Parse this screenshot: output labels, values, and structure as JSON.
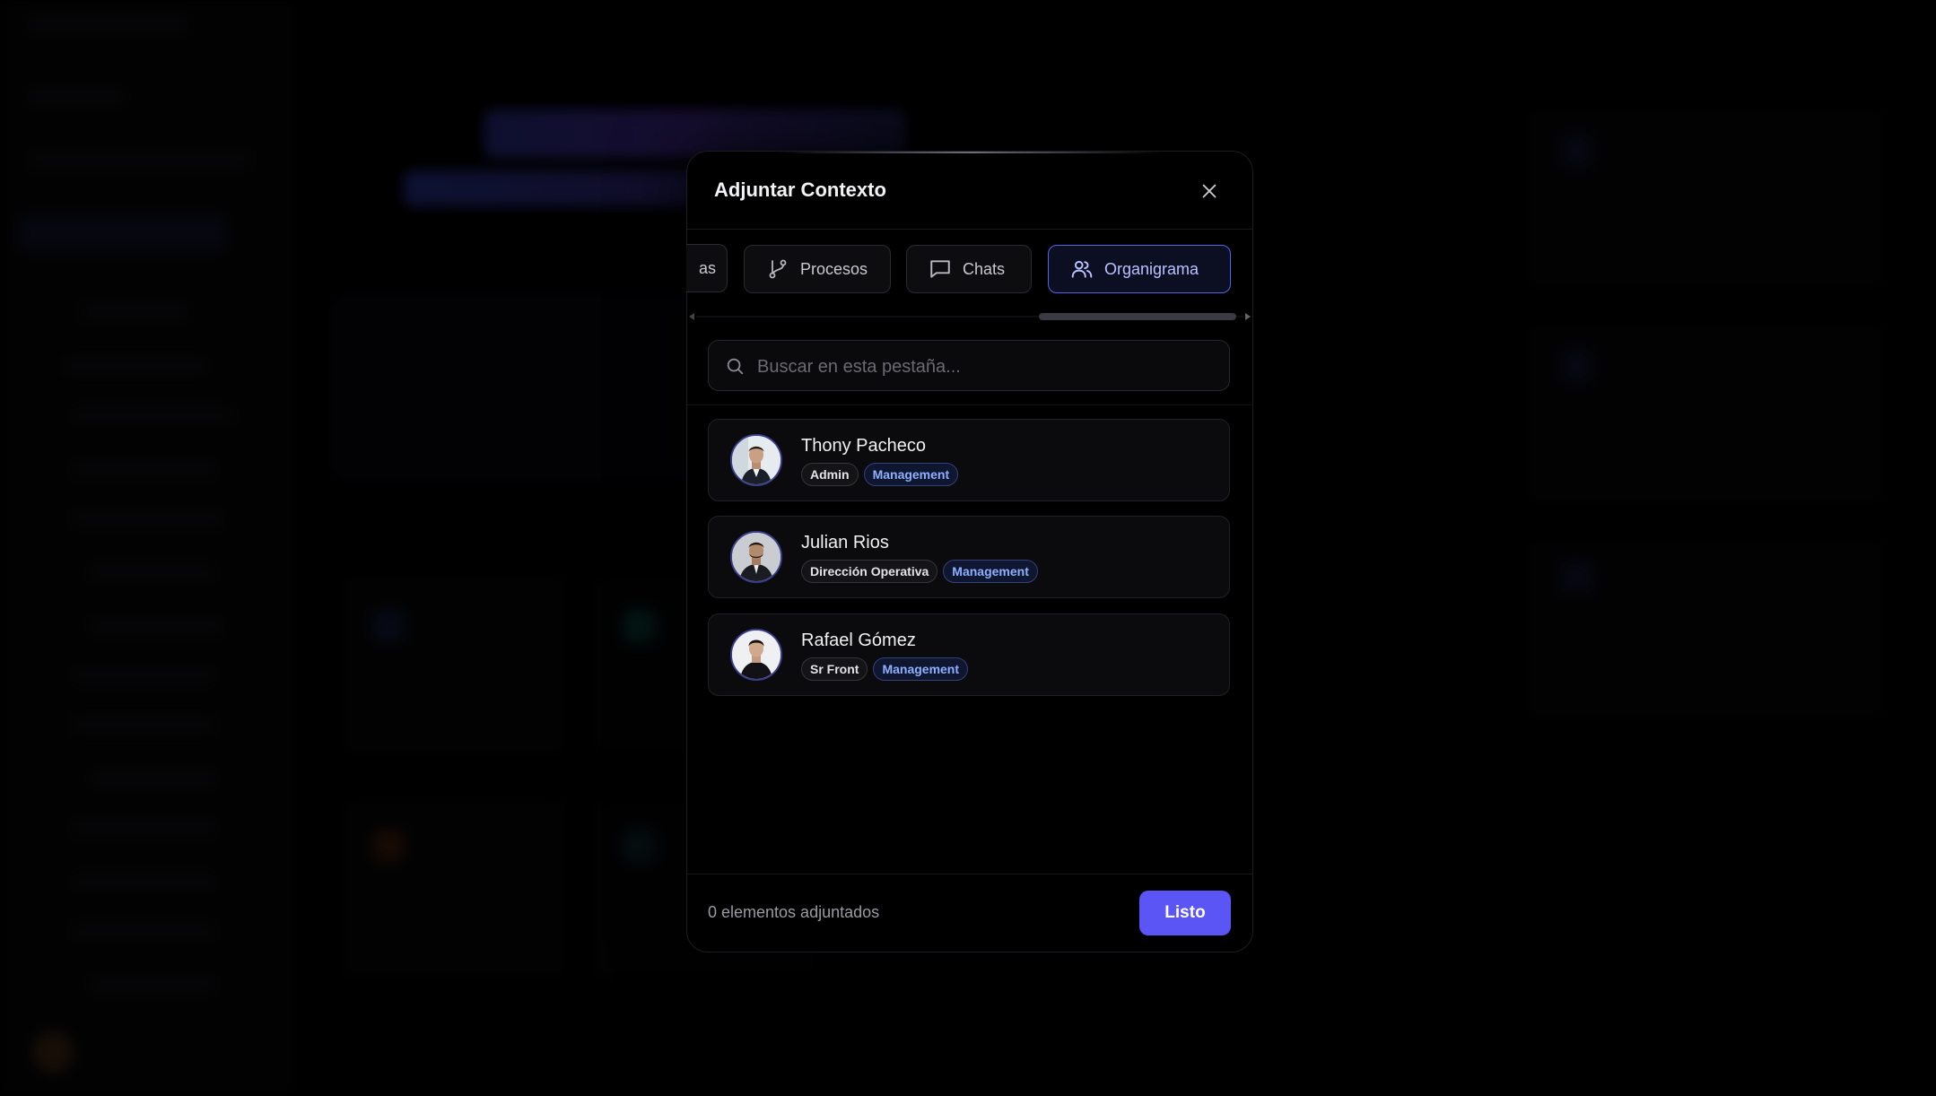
{
  "modal": {
    "title": "Adjuntar Contexto",
    "tabs": [
      {
        "label": "as",
        "icon": "none"
      },
      {
        "label": "Procesos",
        "icon": "git-branch-icon"
      },
      {
        "label": "Chats",
        "icon": "message-square-icon"
      },
      {
        "label": "Organigrama",
        "icon": "users-icon",
        "active": true
      }
    ],
    "search": {
      "placeholder": "Buscar en esta pestaña...",
      "value": ""
    },
    "people": [
      {
        "name": "Thony Pacheco",
        "role": "Admin",
        "department": "Management"
      },
      {
        "name": "Julian Rios",
        "role": "Dirección Operativa",
        "department": "Management"
      },
      {
        "name": "Rafael Gómez",
        "role": "Sr Front",
        "department": "Management"
      }
    ],
    "footer": {
      "count_text": "0 elementos adjuntados",
      "done_label": "Listo"
    }
  },
  "colors": {
    "accent": "#5b55f5",
    "active_tab_border": "#5b5ff0",
    "badge_dept_text": "#8fb0ff",
    "background": "#000000"
  }
}
